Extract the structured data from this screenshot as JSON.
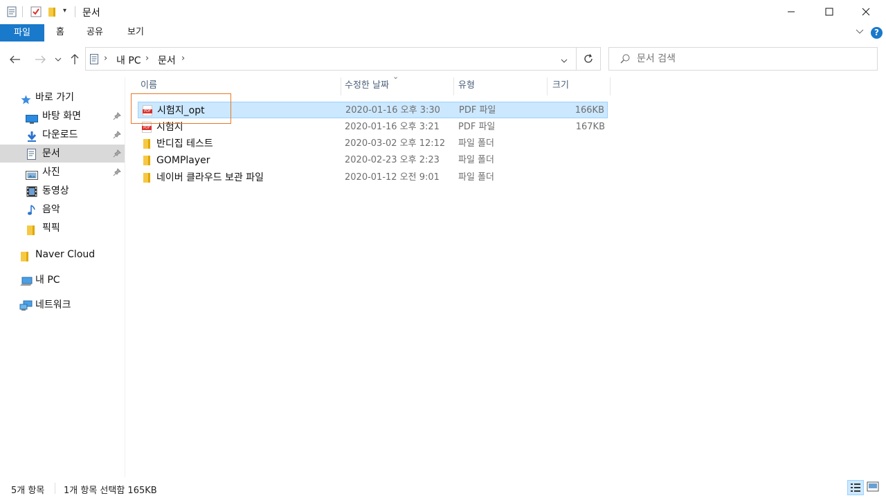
{
  "window": {
    "title": "문서",
    "controls": {
      "minimize": "—",
      "maximize": "☐",
      "close": "✕"
    }
  },
  "ribbon": {
    "tabs": [
      {
        "label": "파일",
        "active": true
      },
      {
        "label": "홈"
      },
      {
        "label": "공유"
      },
      {
        "label": "보기"
      }
    ],
    "accent_color": "#1979ca"
  },
  "address": {
    "breadcrumb": [
      "내 PC",
      "문서"
    ],
    "search_placeholder": "문서 검색"
  },
  "nav_pane": {
    "quick_access": {
      "label": "바로 가기",
      "items": [
        {
          "label": "바탕 화면",
          "icon": "desktop-icon",
          "pinned": true
        },
        {
          "label": "다운로드",
          "icon": "download-icon",
          "pinned": true
        },
        {
          "label": "문서",
          "icon": "document-icon",
          "pinned": true,
          "selected": true
        },
        {
          "label": "사진",
          "icon": "pictures-icon",
          "pinned": true
        },
        {
          "label": "동영상",
          "icon": "video-icon"
        },
        {
          "label": "음악",
          "icon": "music-icon"
        },
        {
          "label": "픽픽",
          "icon": "folder-icon"
        }
      ]
    },
    "roots": [
      {
        "label": "Naver Cloud",
        "icon": "folder-icon"
      },
      {
        "label": "내 PC",
        "icon": "pc-icon"
      },
      {
        "label": "네트워크",
        "icon": "network-icon"
      }
    ]
  },
  "file_list": {
    "columns": [
      "이름",
      "수정한 날짜",
      "유형",
      "크기"
    ],
    "sort_indicator": "⌄",
    "rows": [
      {
        "name": "시험지_opt",
        "date": "2020-01-16 오후 3:30",
        "type": "PDF 파일",
        "size": "166KB",
        "icon": "pdf-icon",
        "selected": true
      },
      {
        "name": "시험지",
        "date": "2020-01-16 오후 3:21",
        "type": "PDF 파일",
        "size": "167KB",
        "icon": "pdf-icon"
      },
      {
        "name": "반디집 테스트",
        "date": "2020-03-02 오후 12:12",
        "type": "파일 폴더",
        "size": "",
        "icon": "folder-icon"
      },
      {
        "name": "GOMPlayer",
        "date": "2020-02-23 오후 2:23",
        "type": "파일 폴더",
        "size": "",
        "icon": "folder-icon"
      },
      {
        "name": "네이버 클라우드 보관 파일",
        "date": "2020-01-12 오전 9:01",
        "type": "파일 폴더",
        "size": "",
        "icon": "folder-icon"
      }
    ],
    "highlight_color": "#e87722"
  },
  "status": {
    "item_count": "5개 항목",
    "selection": "1개 항목 선택함 165KB"
  }
}
